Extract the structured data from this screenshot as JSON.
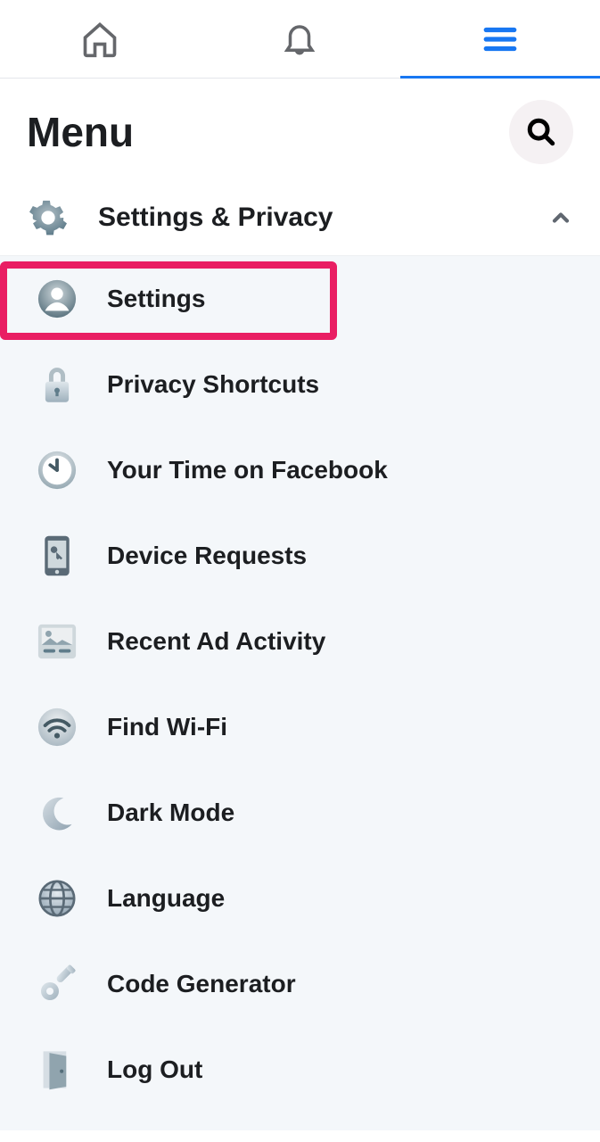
{
  "header": {
    "title": "Menu"
  },
  "section": {
    "label": "Settings & Privacy"
  },
  "items": [
    {
      "label": "Settings"
    },
    {
      "label": "Privacy Shortcuts"
    },
    {
      "label": "Your Time on Facebook"
    },
    {
      "label": "Device Requests"
    },
    {
      "label": "Recent Ad Activity"
    },
    {
      "label": "Find Wi-Fi"
    },
    {
      "label": "Dark Mode"
    },
    {
      "label": "Language"
    },
    {
      "label": "Code Generator"
    },
    {
      "label": "Log Out"
    }
  ]
}
